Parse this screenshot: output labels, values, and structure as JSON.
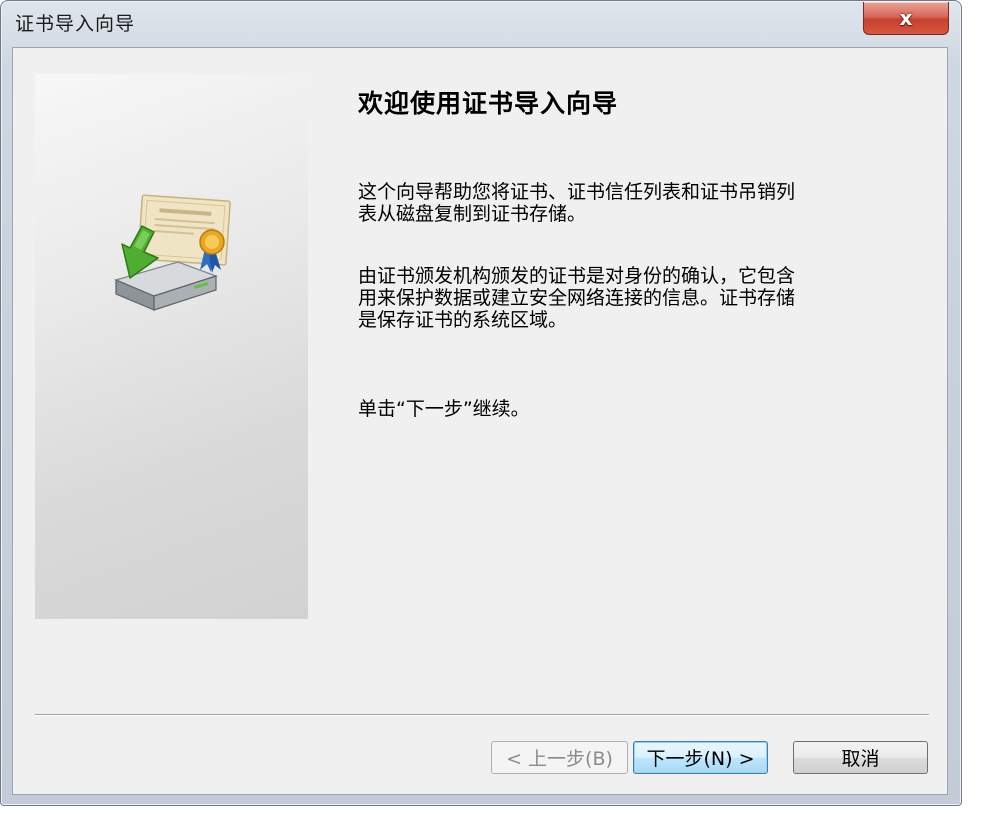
{
  "window": {
    "title": "证书导入向导",
    "close_label": "x"
  },
  "wizard": {
    "heading": "欢迎使用证书导入向导",
    "paragraphs": [
      "这个向导帮助您将证书、证书信任列表和证书吊销列\n表从磁盘复制到证书存储。",
      "由证书颁发机构颁发的证书是对身份的确认，它包含\n用来保护数据或建立安全网络连接的信息。证书存储\n是保存证书的系统区域。",
      "单击“下一步”继续。"
    ],
    "illustration_icon": "certificate-import-icon"
  },
  "buttons": {
    "back_label": "< 上一步(B)",
    "next_label": "下一步(N) >",
    "cancel_label": "取消"
  },
  "colors": {
    "client_background": "#f0f0f0",
    "close_button": "#c7402f",
    "default_button_border": "#3c7fb1",
    "arrow_green": "#4fae2f"
  }
}
